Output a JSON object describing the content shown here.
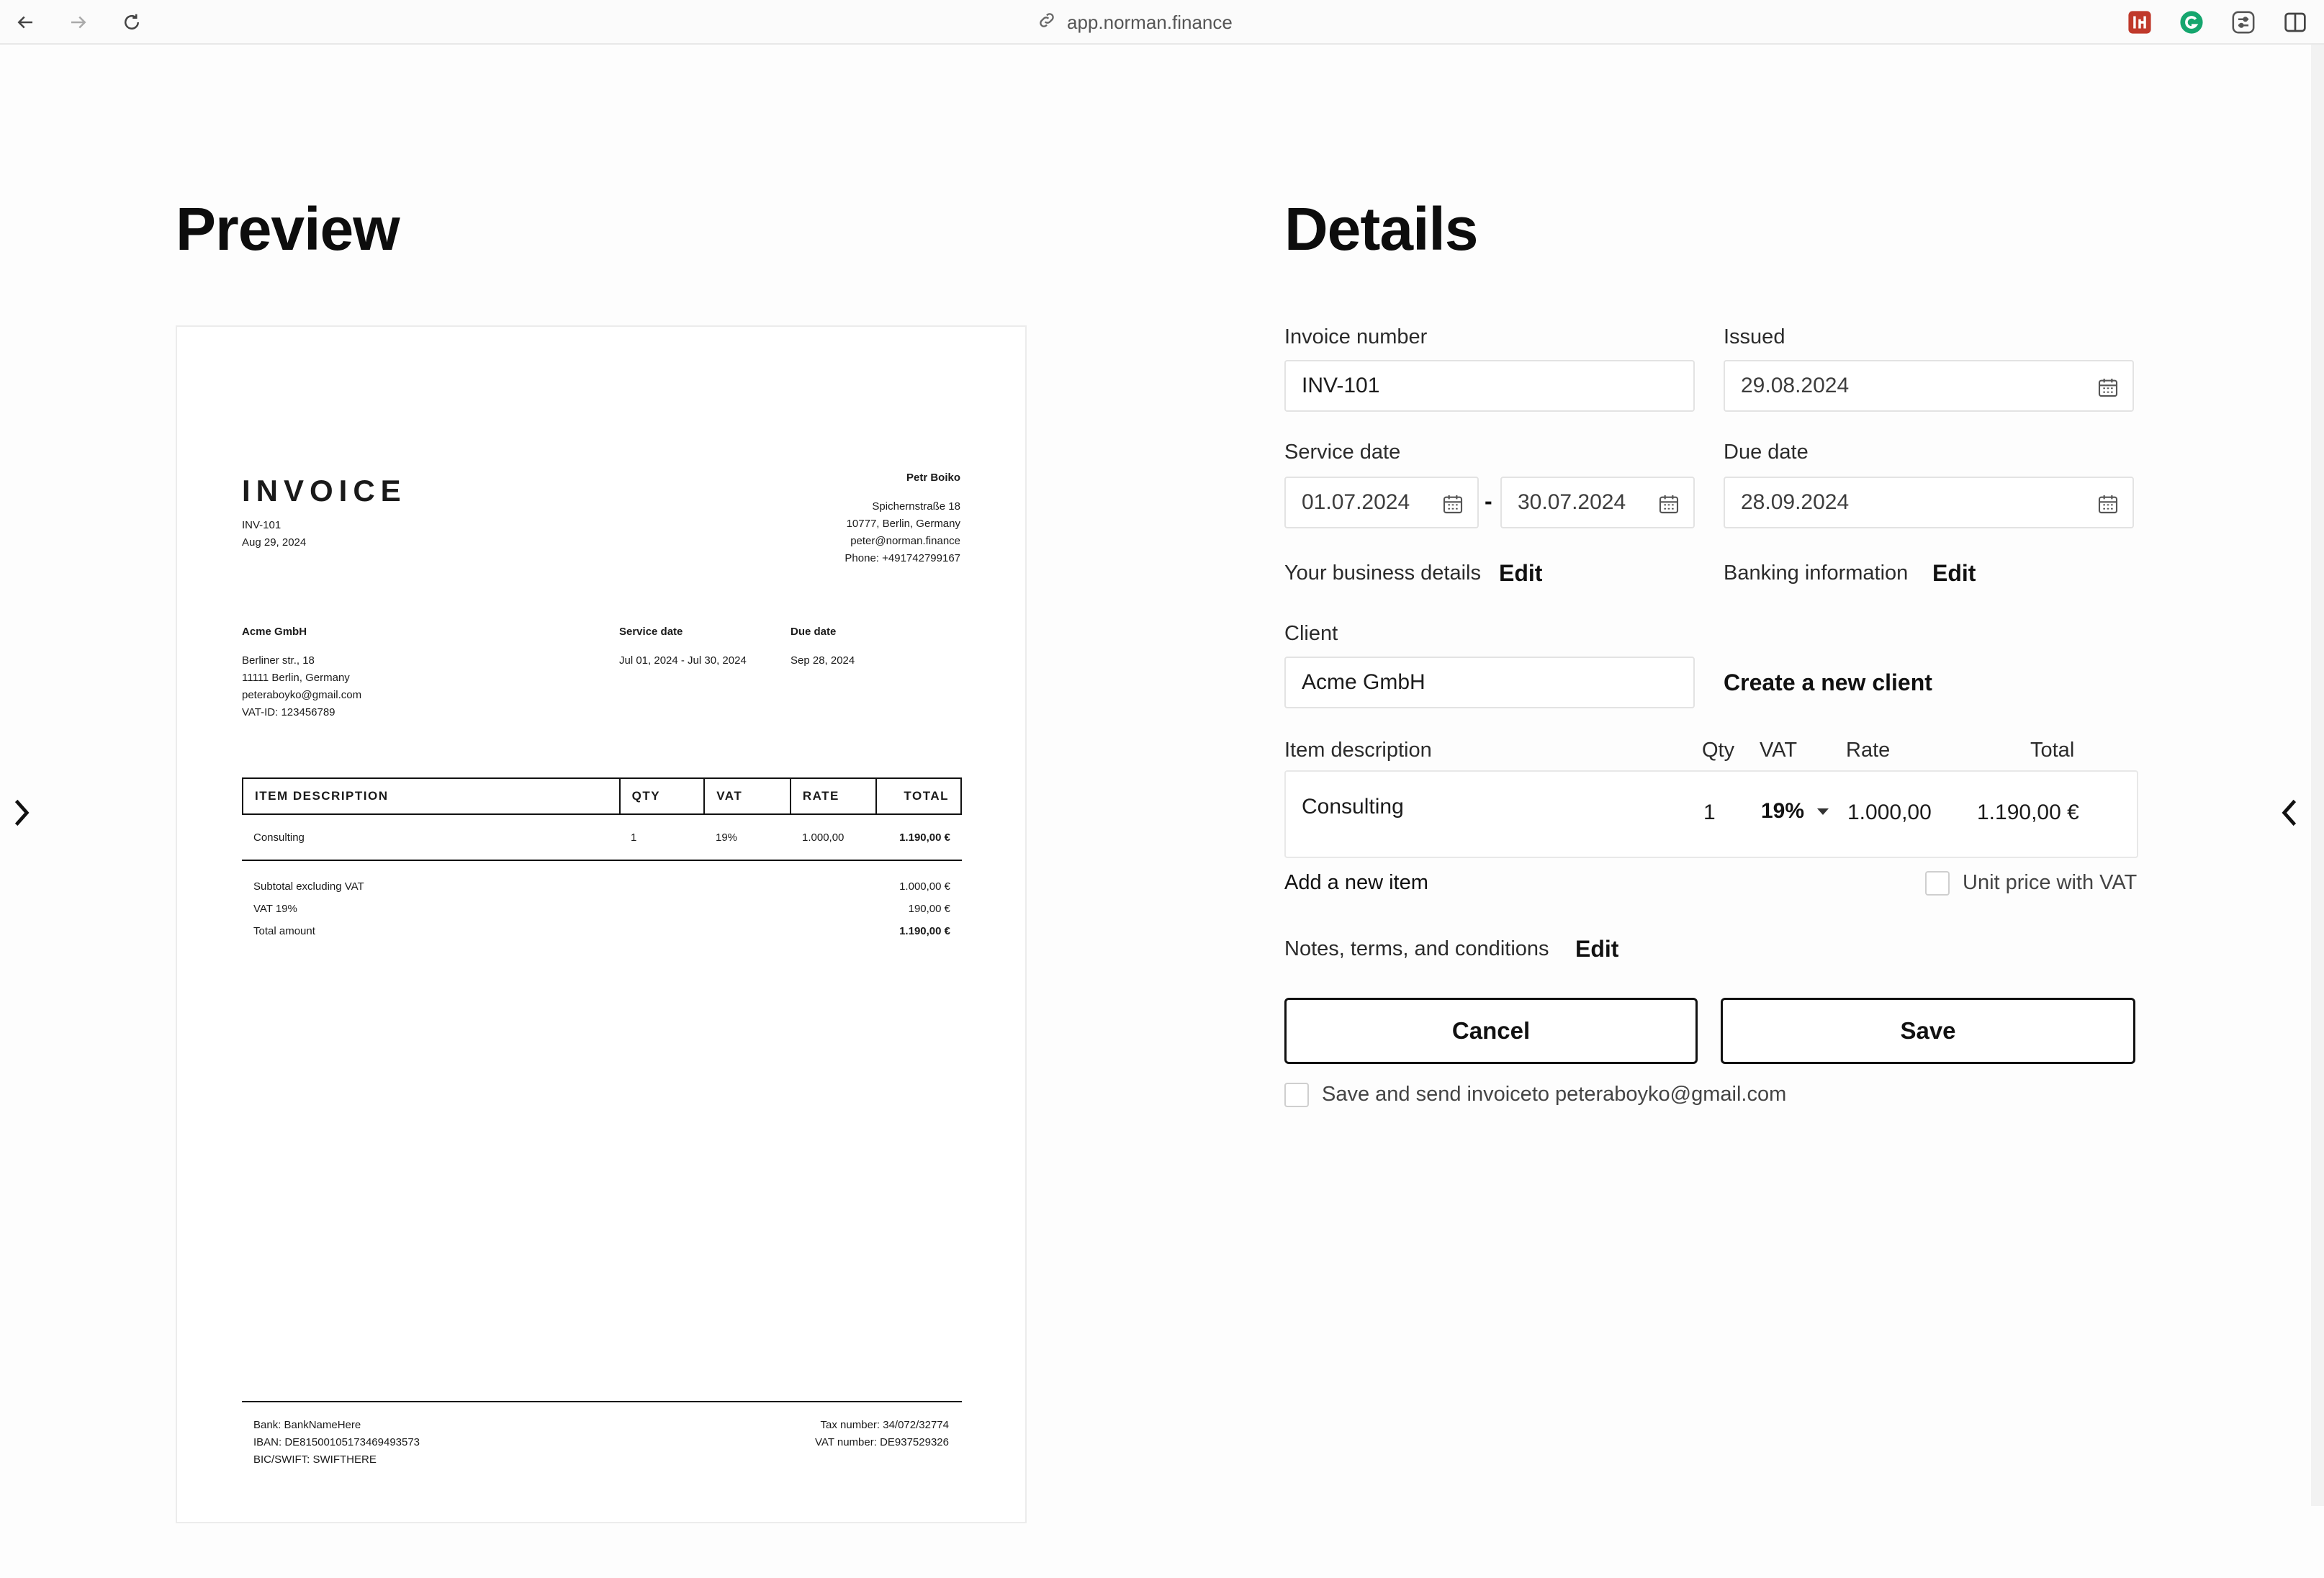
{
  "browser": {
    "url": "app.norman.finance",
    "icons": [
      "back-arrow-icon",
      "forward-arrow-icon",
      "reload-icon",
      "link-icon",
      "extension-icon",
      "grammarly-icon",
      "settings-sliders-icon",
      "sidebar-toggle-icon"
    ],
    "colors": {
      "ext_red": "#c0392b",
      "grammarly_green": "#15a66e"
    }
  },
  "preview": {
    "heading": "Preview",
    "invoice": {
      "title": "INVOICE",
      "number": "INV-101",
      "date": "Aug 29, 2024",
      "sender": {
        "name": "Petr Boiko",
        "street": "Spichernstraße 18",
        "city": "10777, Berlin, Germany",
        "email": "peter@norman.finance",
        "phone": "Phone: +491742799167"
      },
      "client": {
        "name": "Acme GmbH",
        "street": "Berliner str., 18",
        "city": "11111 Berlin, Germany",
        "email": "peteraboyko@gmail.com",
        "vat_id": "VAT-ID: 123456789"
      },
      "service_date_label": "Service date",
      "service_date_value": "Jul 01, 2024 - Jul 30, 2024",
      "due_date_label": "Due date",
      "due_date_value": "Sep 28, 2024",
      "table": {
        "headers": [
          "ITEM DESCRIPTION",
          "QTY",
          "VAT",
          "RATE",
          "TOTAL"
        ],
        "rows": [
          {
            "description": "Consulting",
            "qty": "1",
            "vat": "19%",
            "rate": "1.000,00",
            "total": "1.190,00 €"
          }
        ]
      },
      "totals": {
        "subtotal_label": "Subtotal excluding VAT",
        "subtotal_value": "1.000,00 €",
        "vat_label": "VAT 19%",
        "vat_value": "190,00 €",
        "total_label": "Total amount",
        "total_value": "1.190,00 €"
      },
      "footer": {
        "bank": "Bank: BankNameHere",
        "iban": "IBAN: DE81500105173469493573",
        "bic": "BIC/SWIFT: SWIFTHERE",
        "tax_number": "Tax number: 34/072/32774",
        "vat_number": "VAT number: DE937529326"
      }
    }
  },
  "details": {
    "heading": "Details",
    "invoice_number_label": "Invoice number",
    "invoice_number_value": "INV-101",
    "issued_label": "Issued",
    "issued_value": "29.08.2024",
    "service_date_label": "Service date",
    "service_from": "01.07.2024",
    "service_separator": "-",
    "service_to": "30.07.2024",
    "due_date_label": "Due date",
    "due_date_value": "28.09.2024",
    "business_details_label": "Your business details",
    "business_details_edit": "Edit",
    "banking_label": "Banking information",
    "banking_edit": "Edit",
    "client_label": "Client",
    "client_value": "Acme GmbH",
    "create_client": "Create a new client",
    "items_headers": {
      "description": "Item description",
      "qty": "Qty",
      "vat": "VAT",
      "rate": "Rate",
      "total": "Total"
    },
    "item": {
      "description": "Consulting",
      "qty": "1",
      "vat": "19%",
      "rate": "1.000,00",
      "total": "1.190,00 €"
    },
    "add_item": "Add a new item",
    "unit_price_vat": "Unit price with VAT",
    "notes_label": "Notes, terms, and conditions",
    "notes_edit": "Edit",
    "cancel": "Cancel",
    "save": "Save",
    "send_label": "Save and send invoiceto peteraboyko@gmail.com"
  }
}
